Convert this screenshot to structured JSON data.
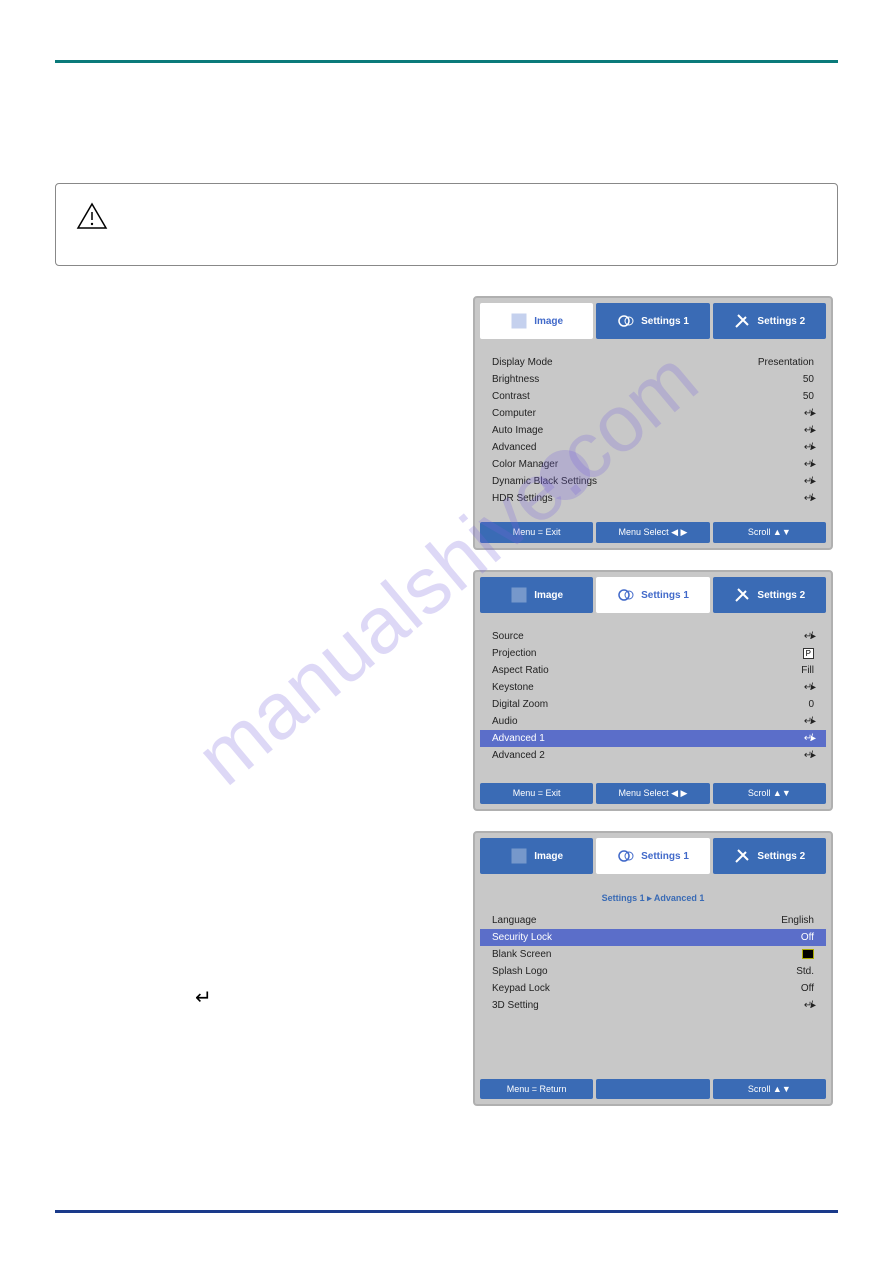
{
  "watermark": "manualshive.com",
  "tabs": {
    "image": "Image",
    "settings1": "Settings 1",
    "settings2": "Settings 2"
  },
  "osd1": {
    "rows": [
      {
        "label": "Display Mode",
        "value": "Presentation"
      },
      {
        "label": "Brightness",
        "value": "50"
      },
      {
        "label": "Contrast",
        "value": "50"
      },
      {
        "label": "Computer",
        "value": "↵/▸"
      },
      {
        "label": "Auto Image",
        "value": "↵/▸"
      },
      {
        "label": "Advanced",
        "value": "↵/▸"
      },
      {
        "label": "Color Manager",
        "value": "↵/▸"
      },
      {
        "label": "Dynamic Black Settings",
        "value": "↵/▸"
      },
      {
        "label": "HDR Settings",
        "value": "↵/▸"
      }
    ],
    "footer": [
      "Menu = Exit",
      "Menu Select ◀ ▶",
      "Scroll ▲▼"
    ]
  },
  "osd2": {
    "rows": [
      {
        "label": "Source",
        "value": "↵/▸"
      },
      {
        "label": "Projection",
        "value": "P"
      },
      {
        "label": "Aspect Ratio",
        "value": "Fill"
      },
      {
        "label": "Keystone",
        "value": "↵/▸"
      },
      {
        "label": "Digital Zoom",
        "value": "0"
      },
      {
        "label": "Audio",
        "value": "↵/▸"
      },
      {
        "label": "Advanced 1",
        "value": "↵/▸",
        "selected": true
      },
      {
        "label": "Advanced 2",
        "value": "↵/▸"
      }
    ],
    "footer": [
      "Menu = Exit",
      "Menu Select ◀ ▶",
      "Scroll ▲▼"
    ]
  },
  "osd3": {
    "breadcrumb": "Settings 1 ▸ Advanced 1",
    "rows": [
      {
        "label": "Language",
        "value": "English"
      },
      {
        "label": "Security Lock",
        "value": "Off",
        "selected": true
      },
      {
        "label": "Blank Screen",
        "value": "■"
      },
      {
        "label": "Splash Logo",
        "value": "Std."
      },
      {
        "label": "Keypad Lock",
        "value": "Off"
      },
      {
        "label": "3D Setting",
        "value": "↵/▸"
      }
    ],
    "footer": [
      "Menu = Return",
      "",
      "Scroll ▲▼"
    ]
  }
}
